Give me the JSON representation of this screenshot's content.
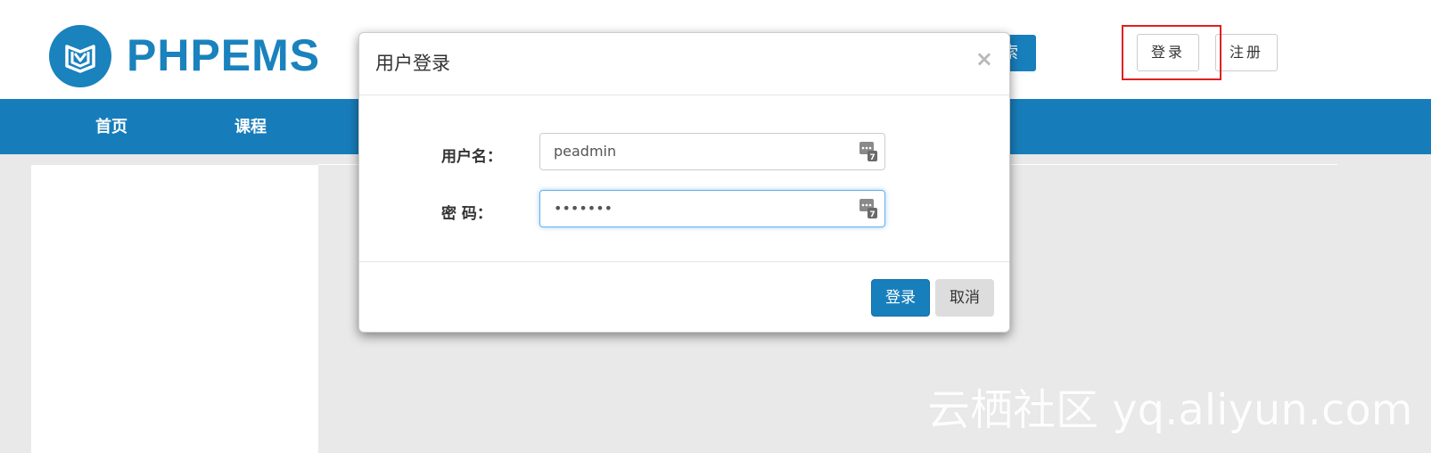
{
  "header": {
    "logo_text": "PHPEMS",
    "search_button_label": "索",
    "login_label": "登录",
    "register_label": "注册"
  },
  "nav": {
    "items": [
      {
        "label": "首页"
      },
      {
        "label": "课程"
      }
    ]
  },
  "modal": {
    "title": "用户登录",
    "close_label": "×",
    "username_label": "用户名：",
    "username_value": "peadmin",
    "password_label": "密  码：",
    "password_value": "•••••••",
    "submit_label": "登录",
    "cancel_label": "取消"
  },
  "watermark": "云栖社区 yq.aliyun.com",
  "colors": {
    "brand_blue": "#187fbd",
    "highlight_red": "#e02020",
    "page_bg": "#e9e9e9"
  },
  "icons": {
    "logo": "book-shield-icon",
    "input_badge": "password-manager-icon"
  }
}
